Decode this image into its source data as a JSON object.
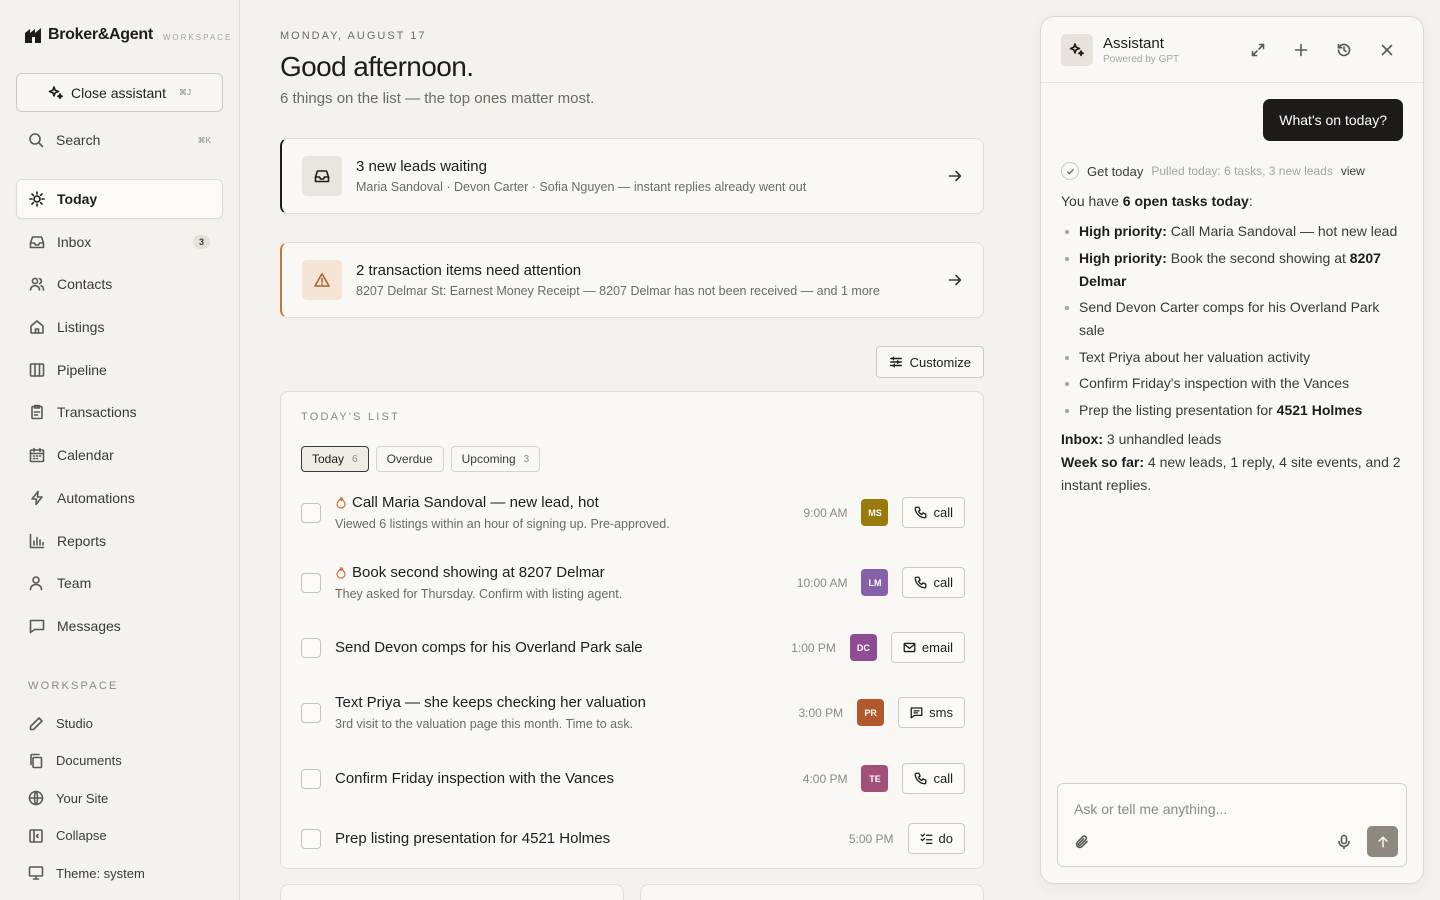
{
  "brand": {
    "name": "Broker&Agent",
    "tag": "WORKSPACE"
  },
  "sidebar": {
    "close_assistant": {
      "label": "Close assistant",
      "shortcut": "⌘J"
    },
    "search": {
      "label": "Search",
      "shortcut": "⌘K"
    },
    "nav": [
      {
        "label": "Today",
        "icon": "sun-icon",
        "active": true
      },
      {
        "label": "Inbox",
        "icon": "inbox-icon",
        "badge": "3"
      },
      {
        "label": "Contacts",
        "icon": "users-icon"
      },
      {
        "label": "Listings",
        "icon": "home-icon"
      },
      {
        "label": "Pipeline",
        "icon": "columns-icon"
      },
      {
        "label": "Transactions",
        "icon": "clipboard-icon"
      },
      {
        "label": "Calendar",
        "icon": "calendar-icon"
      },
      {
        "label": "Automations",
        "icon": "bolt-icon"
      },
      {
        "label": "Reports",
        "icon": "bar-chart-icon"
      },
      {
        "label": "Team",
        "icon": "user-icon"
      },
      {
        "label": "Messages",
        "icon": "message-icon"
      }
    ],
    "workspace_label": "WORKSPACE",
    "workspace": [
      {
        "label": "Studio",
        "icon": "pen-icon"
      },
      {
        "label": "Documents",
        "icon": "copy-icon"
      },
      {
        "label": "Your Site",
        "icon": "globe-icon"
      },
      {
        "label": "Collapse",
        "icon": "sidebar-collapse-icon"
      },
      {
        "label": "Theme: system",
        "icon": "monitor-icon"
      }
    ]
  },
  "main": {
    "date": "MONDAY, AUGUST 17",
    "greeting": "Good afternoon.",
    "subtitle": "6 things on the list — the top ones matter most.",
    "leads_card": {
      "title": "3 new leads waiting",
      "subtitle": "Maria Sandoval · Devon Carter · Sofia Nguyen — instant replies already went out"
    },
    "transaction_card": {
      "title": "2 transaction items need attention",
      "subtitle": "8207 Delmar St: Earnest Money Receipt — 8207 Delmar has not been received — and 1 more"
    },
    "customize_label": "Customize",
    "list_label": "TODAY'S LIST",
    "tabs": [
      {
        "label": "Today",
        "count": "6"
      },
      {
        "label": "Overdue",
        "count": ""
      },
      {
        "label": "Upcoming",
        "count": "3"
      }
    ],
    "tasks": [
      {
        "title": "Call Maria Sandoval — new lead, hot",
        "desc": "Viewed 6 listings within an hour of signing up. Pre-approved.",
        "time": "9:00 AM",
        "initials": "MS",
        "color": "#9a7a0c",
        "action": "call",
        "hot": true
      },
      {
        "title": "Book second showing at 8207 Delmar",
        "desc": "They asked for Thursday. Confirm with listing agent.",
        "time": "10:00 AM",
        "initials": "LM",
        "color": "#8461a8",
        "action": "call",
        "hot": true
      },
      {
        "title": "Send Devon comps for his Overland Park sale",
        "desc": "",
        "time": "1:00 PM",
        "initials": "DC",
        "color": "#8f4c93",
        "action": "email",
        "hot": false
      },
      {
        "title": "Text Priya — she keeps checking her valuation",
        "desc": "3rd visit to the valuation page this month. Time to ask.",
        "time": "3:00 PM",
        "initials": "PR",
        "color": "#b3582a",
        "action": "sms",
        "hot": false
      },
      {
        "title": "Confirm Friday inspection with the Vances",
        "desc": "",
        "time": "4:00 PM",
        "initials": "TE",
        "color": "#a2507a",
        "action": "call",
        "hot": false
      },
      {
        "title": "Prep listing presentation for 4521 Holmes",
        "desc": "",
        "time": "5:00 PM",
        "initials": "",
        "color": "",
        "action": "do",
        "hot": false
      }
    ]
  },
  "assistant": {
    "title": "Assistant",
    "powered": "Powered by GPT",
    "user_message": "What's on today?",
    "tool": {
      "label": "Get today",
      "note": "Pulled today: 6 tasks, 3 new leads",
      "view": "view"
    },
    "intro_pre": "You have ",
    "intro_bold": "6 open tasks today",
    "intro_post": ":",
    "items": [
      {
        "bold": "High priority:",
        "text": " Call Maria Sandoval — hot new lead",
        "bold2": ""
      },
      {
        "bold": "High priority:",
        "text": " Book the second showing at ",
        "bold2": "8207 Delmar"
      },
      {
        "bold": "",
        "text": "Send Devon Carter comps for his Overland Park sale",
        "bold2": ""
      },
      {
        "bold": "",
        "text": "Text Priya about her valuation activity",
        "bold2": ""
      },
      {
        "bold": "",
        "text": "Confirm Friday's inspection with the Vances",
        "bold2": ""
      },
      {
        "bold": "",
        "text": "Prep the listing presentation for ",
        "bold2": "4521 Holmes"
      }
    ],
    "inbox_label": "Inbox:",
    "inbox_text": " 3 unhandled leads",
    "week_label": "Week so far:",
    "week_text": " 4 new leads, 1 reply, 4 site events, and 2 instant replies.",
    "composer_placeholder": "Ask or tell me anything..."
  }
}
